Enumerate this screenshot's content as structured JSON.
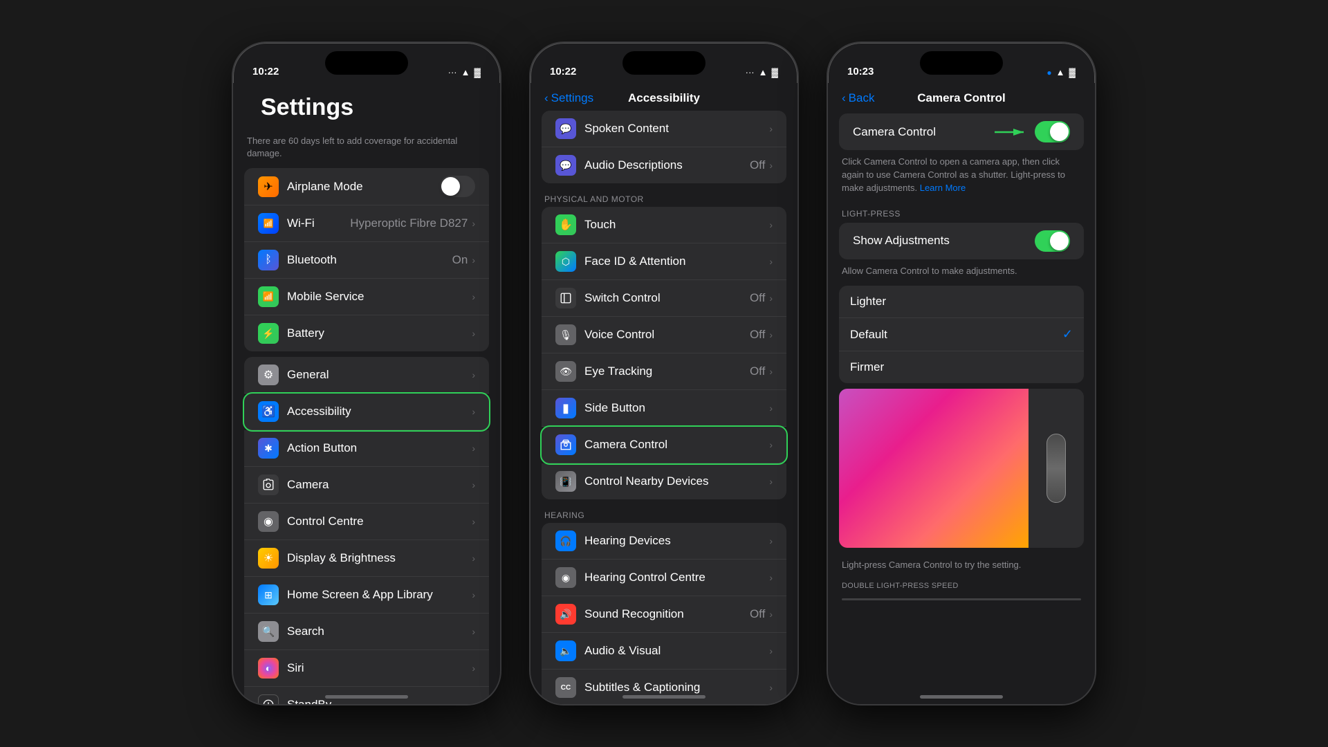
{
  "phones": {
    "phone1": {
      "time": "10:22",
      "title": "Settings",
      "damage_notice": "There are 60 days left to add coverage for accidental damage.",
      "items_group1": [
        {
          "id": "airplane",
          "label": "Airplane Mode",
          "icon_class": "icon-airplane",
          "icon_char": "✈",
          "has_toggle": true,
          "toggle_on": false
        },
        {
          "id": "wifi",
          "label": "Wi-Fi",
          "icon_class": "icon-wifi",
          "icon_char": "📶",
          "value": "Hyperoptic Fibre D827",
          "has_chevron": true
        },
        {
          "id": "bluetooth",
          "label": "Bluetooth",
          "icon_class": "icon-bluetooth",
          "icon_char": "⚡",
          "value": "On",
          "has_chevron": true
        },
        {
          "id": "mobile",
          "label": "Mobile Service",
          "icon_class": "icon-mobile",
          "icon_char": "📱",
          "has_chevron": true
        },
        {
          "id": "battery",
          "label": "Battery",
          "icon_class": "icon-battery",
          "icon_char": "🔋",
          "has_chevron": true
        }
      ],
      "items_group2": [
        {
          "id": "general",
          "label": "General",
          "icon_class": "icon-general",
          "icon_char": "⚙",
          "has_chevron": true
        },
        {
          "id": "accessibility",
          "label": "Accessibility",
          "icon_class": "icon-accessibility",
          "icon_char": "♿",
          "has_chevron": true,
          "highlighted": true
        },
        {
          "id": "action",
          "label": "Action Button",
          "icon_class": "icon-action",
          "icon_char": "✱",
          "has_chevron": true
        },
        {
          "id": "camera",
          "label": "Camera",
          "icon_class": "icon-camera",
          "icon_char": "📷",
          "has_chevron": true
        },
        {
          "id": "control",
          "label": "Control Centre",
          "icon_class": "icon-control",
          "icon_char": "◉",
          "has_chevron": true
        },
        {
          "id": "display",
          "label": "Display & Brightness",
          "icon_class": "icon-display",
          "icon_char": "☀",
          "has_chevron": true
        },
        {
          "id": "homescreen",
          "label": "Home Screen & App Library",
          "icon_class": "icon-homescreen",
          "icon_char": "⊞",
          "has_chevron": true
        },
        {
          "id": "search",
          "label": "Search",
          "icon_class": "icon-search",
          "icon_char": "🔍",
          "has_chevron": true
        },
        {
          "id": "siri",
          "label": "Siri",
          "icon_class": "icon-siri",
          "icon_char": "◐",
          "has_chevron": true
        },
        {
          "id": "standby",
          "label": "StandBy",
          "icon_class": "icon-standby",
          "icon_char": "⏻",
          "has_chevron": true
        }
      ]
    },
    "phone2": {
      "time": "10:22",
      "back_label": "Settings",
      "title": "Accessibility",
      "items_vision": [
        {
          "id": "spoken",
          "label": "Spoken Content",
          "icon_class": "icon-spoken",
          "icon_char": "💬",
          "has_chevron": true
        },
        {
          "id": "audiodesc",
          "label": "Audio Descriptions",
          "icon_class": "icon-audio-desc",
          "icon_char": "💬",
          "value": "Off",
          "has_chevron": true
        }
      ],
      "section_physical": "PHYSICAL AND MOTOR",
      "items_physical": [
        {
          "id": "touch",
          "label": "Touch",
          "icon_class": "icon-touch",
          "icon_char": "✋",
          "has_chevron": true
        },
        {
          "id": "faceid",
          "label": "Face ID & Attention",
          "icon_class": "icon-faceid",
          "icon_char": "⬡",
          "has_chevron": true
        },
        {
          "id": "switch",
          "label": "Switch Control",
          "icon_class": "icon-switch",
          "icon_char": "⊞",
          "value": "Off",
          "has_chevron": true
        },
        {
          "id": "voice",
          "label": "Voice Control",
          "icon_class": "icon-voice",
          "icon_char": "🎙",
          "value": "Off",
          "has_chevron": true
        },
        {
          "id": "eye",
          "label": "Eye Tracking",
          "icon_class": "icon-eye",
          "icon_char": "👁",
          "value": "Off",
          "has_chevron": true
        },
        {
          "id": "side",
          "label": "Side Button",
          "icon_class": "icon-side",
          "icon_char": "▮",
          "has_chevron": true
        },
        {
          "id": "cameracontrol",
          "label": "Camera Control",
          "icon_class": "icon-cameractrl",
          "icon_char": "⊕",
          "has_chevron": true,
          "highlighted": true
        },
        {
          "id": "nearby",
          "label": "Control Nearby Devices",
          "icon_class": "icon-nearby",
          "icon_char": "📳",
          "has_chevron": true
        }
      ],
      "section_hearing": "HEARING",
      "items_hearing": [
        {
          "id": "hearingdev",
          "label": "Hearing Devices",
          "icon_class": "icon-hearing",
          "icon_char": "🎧",
          "has_chevron": true
        },
        {
          "id": "hearingcc",
          "label": "Hearing Control Centre",
          "icon_class": "icon-hearingcc",
          "icon_char": "◉",
          "has_chevron": true
        },
        {
          "id": "soundrec",
          "label": "Sound Recognition",
          "icon_class": "icon-sound",
          "icon_char": "🔊",
          "value": "Off",
          "has_chevron": true
        },
        {
          "id": "audiovisual",
          "label": "Audio & Visual",
          "icon_class": "icon-audiovisual",
          "icon_char": "🔈",
          "has_chevron": true
        },
        {
          "id": "subtitles",
          "label": "Subtitles & Captioning",
          "icon_class": "icon-subtitles",
          "icon_char": "CC",
          "has_chevron": true
        }
      ]
    },
    "phone3": {
      "time": "10:23",
      "back_label": "Back",
      "title": "Camera Control",
      "toggle_camera_label": "Camera Control",
      "toggle_camera_on": true,
      "description": "Click Camera Control to open a camera app, then click again to use Camera Control as a shutter. Light-press to make adjustments.",
      "learn_more": "Learn More",
      "section_light_press": "LIGHT-PRESS",
      "show_adjustments_label": "Show Adjustments",
      "show_adjustments_on": true,
      "adjustments_desc": "Allow Camera Control to make adjustments.",
      "selector_items": [
        {
          "id": "lighter",
          "label": "Lighter",
          "selected": false
        },
        {
          "id": "default",
          "label": "Default",
          "selected": true
        },
        {
          "id": "firmer",
          "label": "Firmer",
          "selected": false
        }
      ],
      "preview_caption": "Light-press Camera Control to try the setting.",
      "section_double": "DOUBLE LIGHT-PRESS SPEED"
    }
  }
}
